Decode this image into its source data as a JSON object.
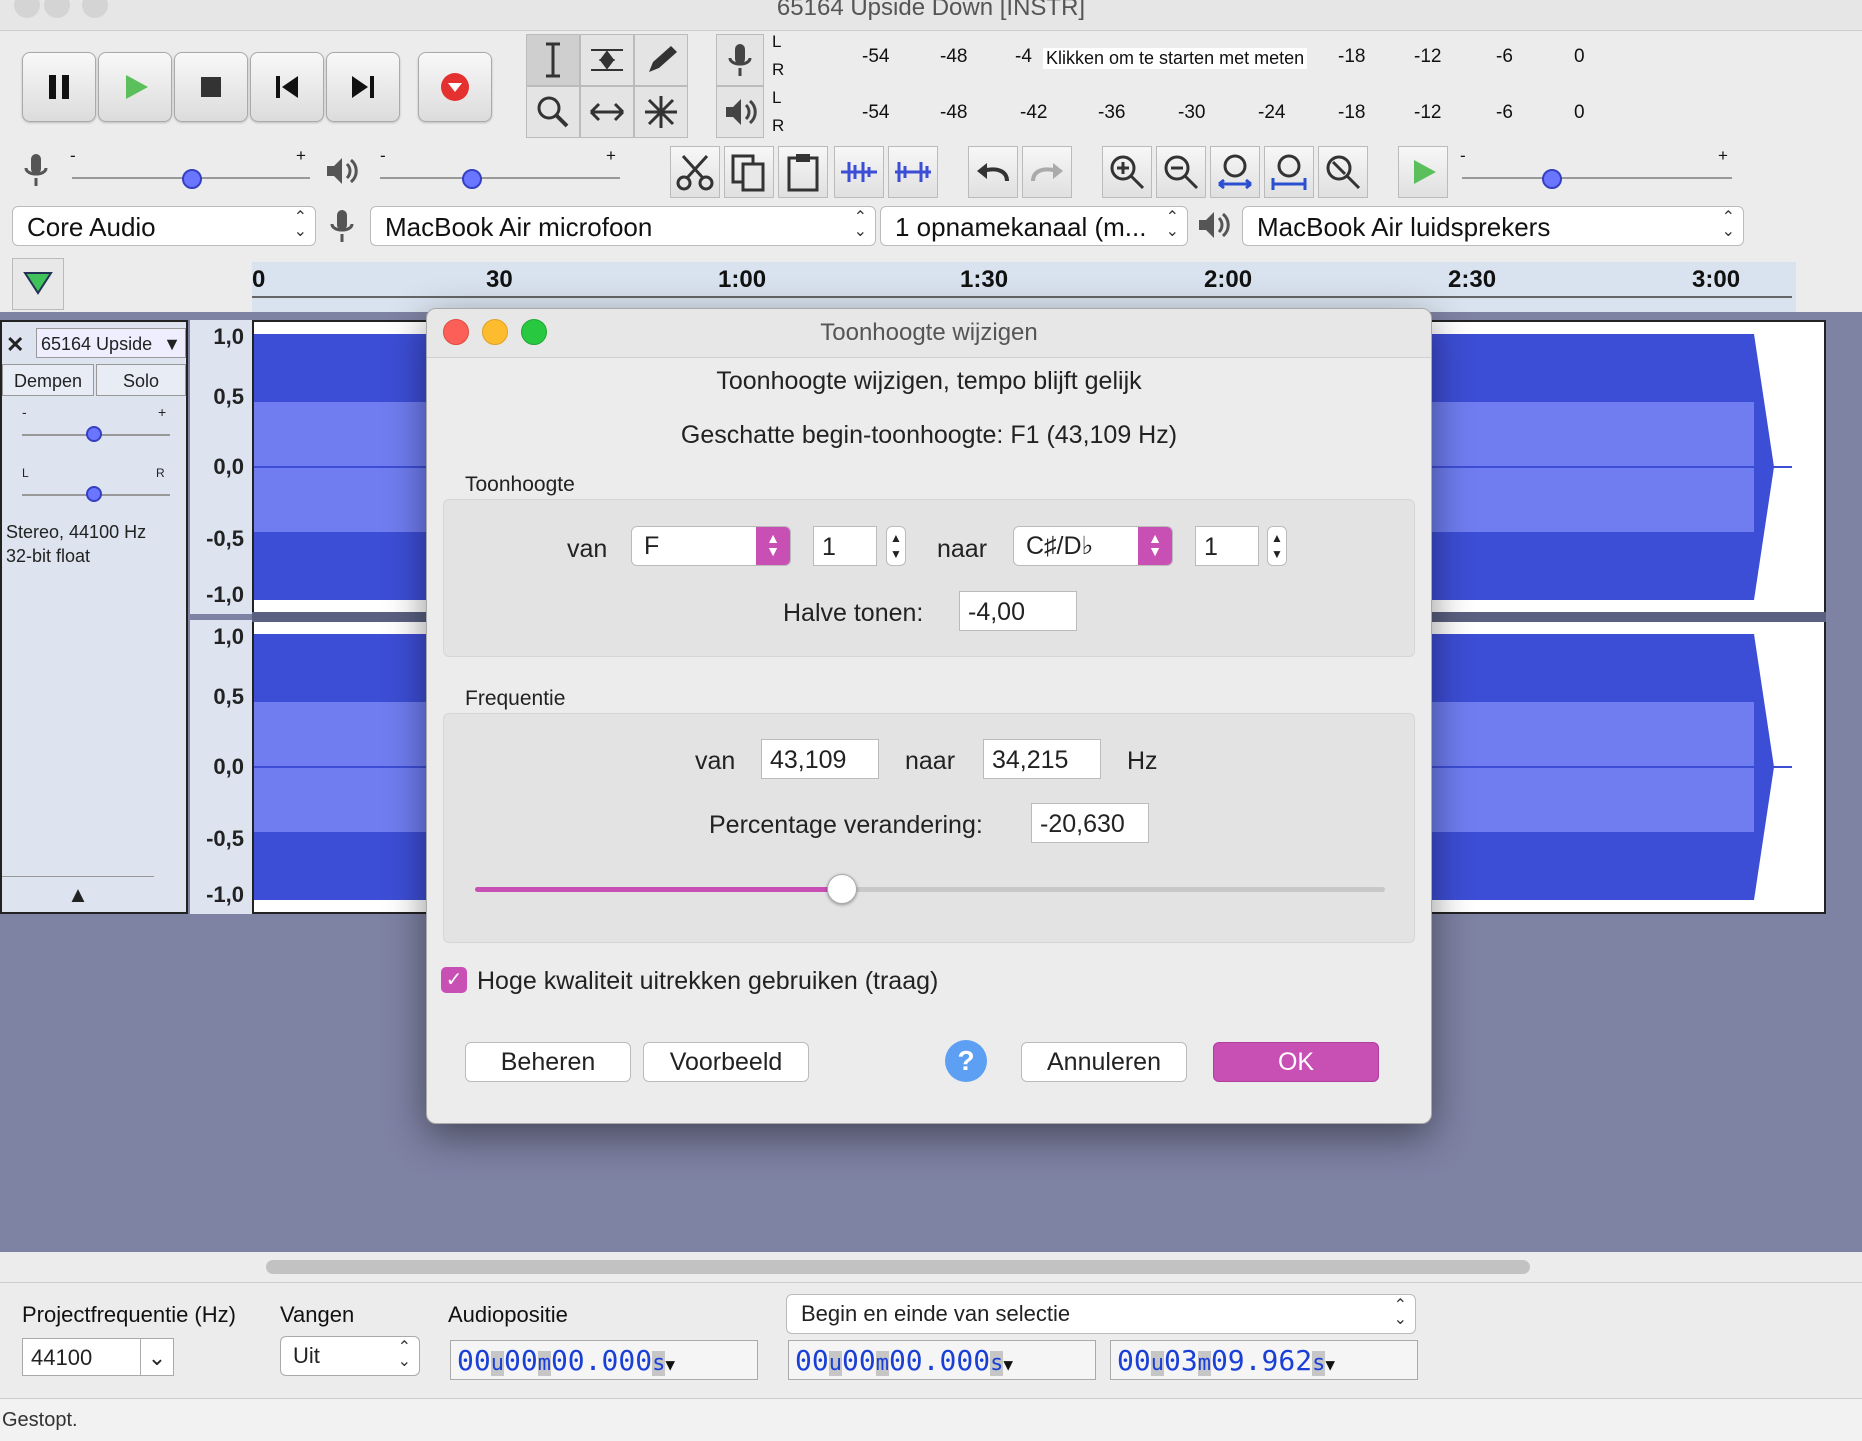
{
  "window": {
    "title": "65164 Upside Down [INSTR]"
  },
  "meters": {
    "record_scale": [
      "-54",
      "-48",
      "-4⁢",
      "-18",
      "-12",
      "-6",
      "0"
    ],
    "record_hint": "Klikken om te starten met meten",
    "play_scale": [
      "-54",
      "-48",
      "-42",
      "-36",
      "-30",
      "-24",
      "-18",
      "-12",
      "-6",
      "0"
    ],
    "channel_l": "L",
    "channel_r": "R"
  },
  "mixer": {
    "minus": "-",
    "plus": "+"
  },
  "devices": {
    "host": "Core Audio",
    "input": "MacBook Air microfoon",
    "channels": "1 opnamekanaal (m...",
    "output": "MacBook Air luidsprekers"
  },
  "timeline": {
    "labels": [
      "0",
      "30",
      "1:00",
      "1:30",
      "2:00",
      "2:30",
      "3:00"
    ]
  },
  "track": {
    "name": "65164 Upside",
    "mute": "Dempen",
    "solo": "Solo",
    "pan_l": "L",
    "pan_r": "R",
    "info_line1": "Stereo, 44100 Hz",
    "info_line2": "32-bit float",
    "scale": [
      "1,0",
      "0,5",
      "0,0",
      "-0,5",
      "-1,0"
    ]
  },
  "dialog": {
    "title": "Toonhoogte wijzigen",
    "subtitle": "Toonhoogte wijzigen, tempo blijft gelijk",
    "estimate": "Geschatte begin-toonhoogte: F1 (43,109 Hz)",
    "pitch_group": "Toonhoogte",
    "from_label": "van",
    "to_label": "naar",
    "from_note": "F",
    "from_octave": "1",
    "to_note": "C♯/D♭",
    "to_octave": "1",
    "semitones_label": "Halve tonen:",
    "semitones": "-4,00",
    "freq_group": "Frequentie",
    "freq_from_label": "van",
    "freq_from": "43,109",
    "freq_to_label": "naar",
    "freq_to": "34,215",
    "hz": "Hz",
    "percent_label": "Percentage verandering:",
    "percent": "-20,630",
    "slider_fraction": 0.402,
    "hq_label": "Hoge kwaliteit uitrekken gebruiken (traag)",
    "hq_checked": true,
    "manage": "Beheren",
    "preview": "Voorbeeld",
    "help": "?",
    "cancel": "Annuleren",
    "ok": "OK"
  },
  "bottom": {
    "rate_label": "Projectfrequentie (Hz)",
    "rate": "44100",
    "snap_label": "Vangen",
    "snap": "Uit",
    "pos_label": "Audiopositie",
    "sel_mode": "Begin en einde van selectie",
    "pos_tc": [
      "00",
      "u",
      "00",
      "m",
      "00.000",
      "s"
    ],
    "start_tc": [
      "00",
      "u",
      "00",
      "m",
      "00.000",
      "s"
    ],
    "end_tc": [
      "00",
      "u",
      "03",
      "m",
      "09.962",
      "s"
    ],
    "status": "Gestopt."
  },
  "colors": {
    "accent": "#c84fb4",
    "waveform": "#3d4ed6",
    "waveform_rms": "#6f7df0",
    "track_bg": "#7e82a3"
  }
}
